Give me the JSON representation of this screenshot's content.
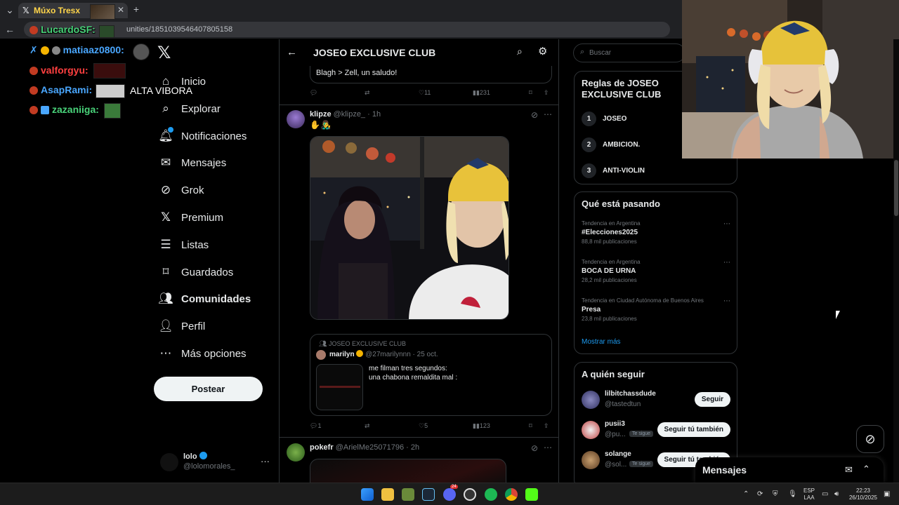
{
  "browser": {
    "tab_title": "Múxo Tresx",
    "url": "unities/1851039546407805158"
  },
  "stream_chat": [
    {
      "user": "LucardoSF",
      "suffix": ":",
      "color": "#49d37a"
    },
    {
      "user": "matiaaz0800",
      "suffix": ":",
      "color": "#4aa7ff"
    },
    {
      "user": "valforgyu",
      "suffix": ":",
      "color": "#ff4040"
    },
    {
      "user": "AsapRami",
      "suffix": ":",
      "color": "#4aa7ff",
      "message": "ALTA VIBORA"
    },
    {
      "user": "zazaniiga",
      "suffix": ":",
      "color": "#49d37a"
    }
  ],
  "nav": {
    "items": [
      {
        "label": "Inicio",
        "icon": "home-icon"
      },
      {
        "label": "Explorar",
        "icon": "search-icon"
      },
      {
        "label": "Notificaciones",
        "icon": "bell-icon"
      },
      {
        "label": "Mensajes",
        "icon": "mail-icon"
      },
      {
        "label": "Grok",
        "icon": "grok-icon"
      },
      {
        "label": "Premium",
        "icon": "x-icon"
      },
      {
        "label": "Listas",
        "icon": "list-icon"
      },
      {
        "label": "Guardados",
        "icon": "bookmark-icon"
      },
      {
        "label": "Comunidades",
        "icon": "communities-icon"
      },
      {
        "label": "Perfil",
        "icon": "profile-icon"
      },
      {
        "label": "Más opciones",
        "icon": "more-icon"
      }
    ],
    "active": "Comunidades",
    "post_label": "Postear"
  },
  "account": {
    "name": "lolo",
    "handle": "@lolomorales_",
    "more": "···"
  },
  "community": {
    "title": "JOSEO EXCLUSIVE CLUB"
  },
  "posts": [
    {
      "text": "Blagh > Zell, un saludo!",
      "actions": {
        "replies": "",
        "reposts": "",
        "likes": "11",
        "views": "231"
      }
    },
    {
      "author": "klipze",
      "handle": "@klipze_",
      "time": "· 1h",
      "text": "✋👨‍🎤",
      "quote": {
        "community": "JOSEO EXCLUSIVE CLUB",
        "author": "marilyn",
        "handle": "@27marilynnn",
        "time": "· 25 oct.",
        "line1": "me filman tres segundos:",
        "line2": "una chabona remaldita mal :"
      },
      "actions": {
        "replies": "1",
        "reposts": "",
        "likes": "5",
        "views": "123"
      }
    },
    {
      "author": "pokefr",
      "handle": "@ArielMe25071796",
      "time": "· 2h"
    }
  ],
  "search": {
    "placeholder": "Buscar"
  },
  "rules": {
    "title": "Reglas de JOSEO EXCLUSIVE CLUB",
    "items": [
      {
        "num": "1",
        "label": "JOSEO"
      },
      {
        "num": "2",
        "label": "AMBICION."
      },
      {
        "num": "3",
        "label": "ANTI-VIOLIN"
      }
    ]
  },
  "trends": {
    "title": "Qué está pasando",
    "items": [
      {
        "context": "Tendencia en Argentina",
        "name": "#Elecciones2025",
        "count": "88,8 mil publicaciones"
      },
      {
        "context": "Tendencia en Argentina",
        "name": "BOCA DE URNA",
        "count": "28,2 mil publicaciones"
      },
      {
        "context": "Tendencia en Ciudad Autónoma de Buenos Aires",
        "name": "Presa",
        "count": "23,8 mil publicaciones"
      }
    ],
    "show_more": "Mostrar más"
  },
  "who_to_follow": {
    "title": "A quién seguir",
    "items": [
      {
        "name": "lilbitchassdude",
        "handle": "@tastedtun",
        "badge": "",
        "button": "Seguir"
      },
      {
        "name": "pusii3",
        "handle": "@pu...",
        "badge": "Te sigue",
        "button": "Seguir tú también"
      },
      {
        "name": "solange",
        "handle": "@sol...",
        "badge": "Te sigue",
        "button": "Seguir tú también"
      }
    ]
  },
  "messages_drawer": {
    "title": "Mensajes"
  },
  "taskbar": {
    "lang_top": "ESP",
    "lang_bottom": "LAA",
    "time": "22:23",
    "date": "26/10/2025",
    "discord_badge": "24"
  },
  "colors": {
    "accent": "#1d9bf0",
    "background": "#000000",
    "border": "#2f3336",
    "muted": "#71767b"
  }
}
